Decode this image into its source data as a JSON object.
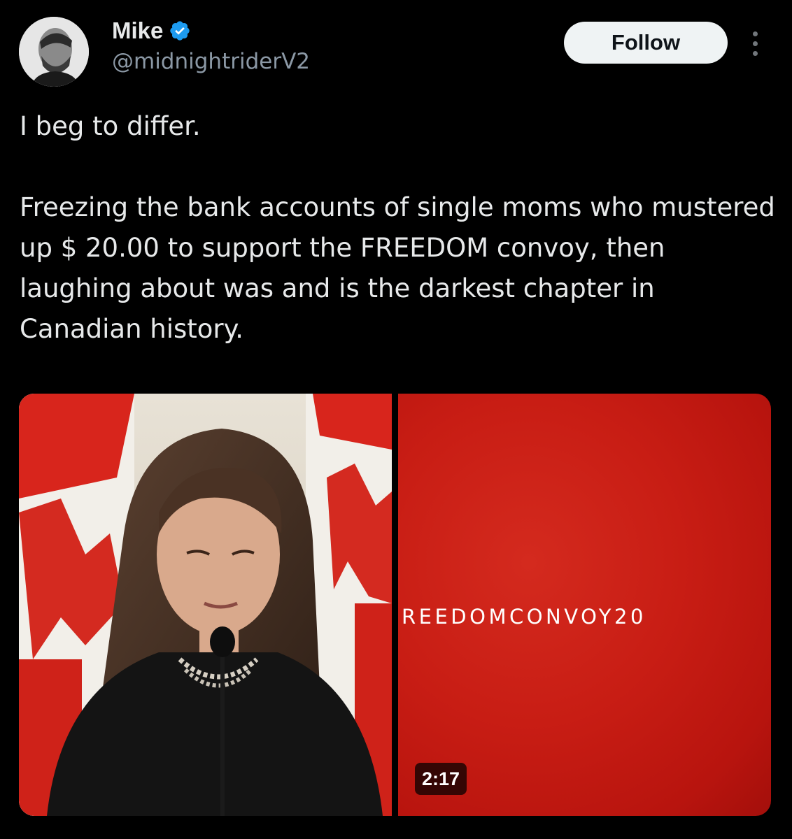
{
  "user": {
    "display_name": "Mike",
    "handle": "@midnightriderV2",
    "verified": true
  },
  "actions": {
    "follow_label": "Follow"
  },
  "tweet": {
    "paragraph1": "I beg to differ.",
    "paragraph2": "Freezing the bank accounts of single moms who mustered up $ 20.00 to support the FREEDOM convoy, then laughing about was and is the darkest chapter in Canadian history."
  },
  "media": {
    "left_image": "woman speaking at microphone in front of Canadian flags",
    "video_banner_text": "REEDOMCONVOY20",
    "video_duration": "2:17"
  },
  "colors": {
    "background": "#000000",
    "text_primary": "#e7e9ea",
    "text_secondary": "#8b98a5",
    "verified_blue": "#1d9bf0",
    "follow_bg": "#eff3f4",
    "video_red": "#c81d14"
  },
  "icons": {
    "verified": "verified-badge-icon",
    "more": "more-dots-icon"
  }
}
